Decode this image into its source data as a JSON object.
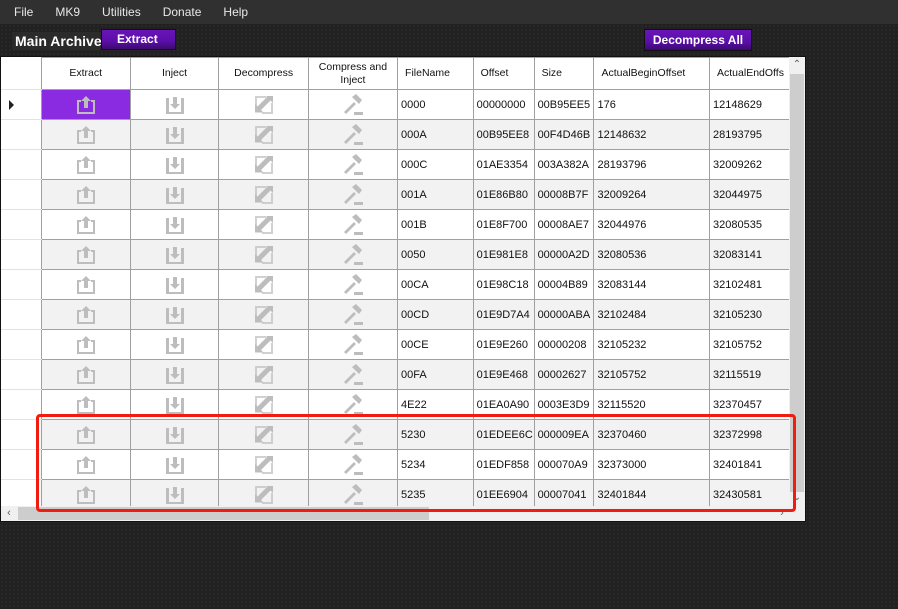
{
  "menu": [
    "File",
    "MK9",
    "Utilities",
    "Donate",
    "Help"
  ],
  "toolbar": {
    "archive_label": "Main Archive",
    "extract_label": "Extract",
    "decompress_all_label": "Decompress All"
  },
  "grid": {
    "columns": [
      "Extract",
      "Inject",
      "Decompress",
      "Compress and Inject",
      "FileName",
      "Offset",
      "Size",
      "ActualBeginOffset",
      "ActualEndOffs"
    ],
    "selected_row": 0,
    "icons": {
      "extract": "upload-tray-icon",
      "inject": "download-tray-icon",
      "decompress": "expand-arrows-icon",
      "compress_inject": "gavel-icon"
    },
    "rows": [
      {
        "file": "0000",
        "offset": "00000000",
        "size": "00B95EE5",
        "begin": "176",
        "end": "12148629"
      },
      {
        "file": "000A",
        "offset": "00B95EE8",
        "size": "00F4D46B",
        "begin": "12148632",
        "end": "28193795"
      },
      {
        "file": "000C",
        "offset": "01AE3354",
        "size": "003A382A",
        "begin": "28193796",
        "end": "32009262"
      },
      {
        "file": "001A",
        "offset": "01E86B80",
        "size": "00008B7F",
        "begin": "32009264",
        "end": "32044975"
      },
      {
        "file": "001B",
        "offset": "01E8F700",
        "size": "00008AE7",
        "begin": "32044976",
        "end": "32080535"
      },
      {
        "file": "0050",
        "offset": "01E981E8",
        "size": "00000A2D",
        "begin": "32080536",
        "end": "32083141"
      },
      {
        "file": "00CA",
        "offset": "01E98C18",
        "size": "00004B89",
        "begin": "32083144",
        "end": "32102481"
      },
      {
        "file": "00CD",
        "offset": "01E9D7A4",
        "size": "00000ABA",
        "begin": "32102484",
        "end": "32105230"
      },
      {
        "file": "00CE",
        "offset": "01E9E260",
        "size": "00000208",
        "begin": "32105232",
        "end": "32105752"
      },
      {
        "file": "00FA",
        "offset": "01E9E468",
        "size": "00002627",
        "begin": "32105752",
        "end": "32115519"
      },
      {
        "file": "4E22",
        "offset": "01EA0A90",
        "size": "0003E3D9",
        "begin": "32115520",
        "end": "32370457"
      },
      {
        "file": "5230",
        "offset": "01EDEE6C",
        "size": "000009EA",
        "begin": "32370460",
        "end": "32372998"
      },
      {
        "file": "5234",
        "offset": "01EDF858",
        "size": "000070A9",
        "begin": "32373000",
        "end": "32401841"
      },
      {
        "file": "5235",
        "offset": "01EE6904",
        "size": "00007041",
        "begin": "32401844",
        "end": "32430581"
      }
    ]
  },
  "colors": {
    "accent_purple": "#8a2be2",
    "button_purple": "#5a0ea8",
    "highlight_red": "#f21b0f",
    "icon_gray": "#bdbdbd"
  }
}
